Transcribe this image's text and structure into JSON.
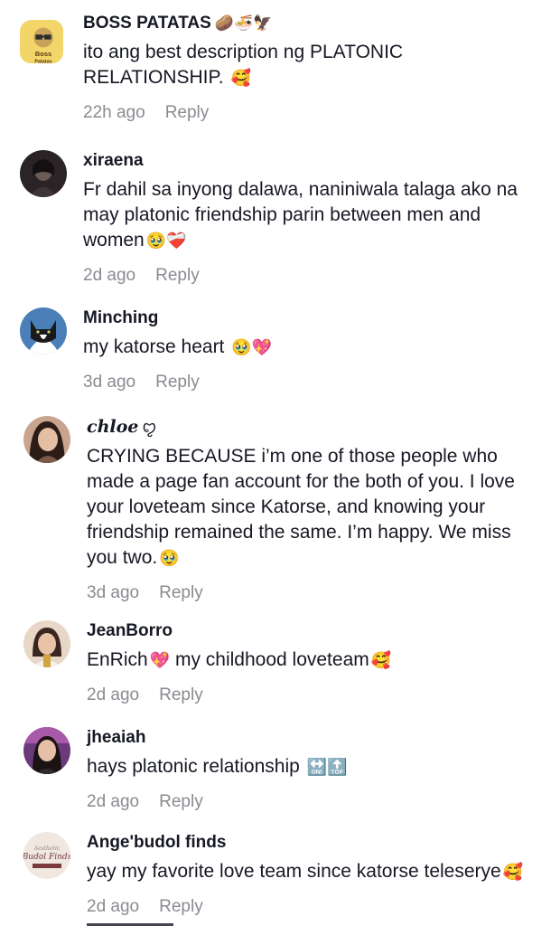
{
  "comments": [
    {
      "username": "BOSS PATATAS",
      "username_decoration": "🥔🍜🦅",
      "text": "ito ang best description ng PLATONIC RELATIONSHIP.",
      "emoji": "🥰",
      "time": "22h ago",
      "reply": "Reply",
      "avatar_text": "Boss Patatas",
      "avatar_bg": "#f2d66a"
    },
    {
      "username": "xiraena",
      "username_decoration": "",
      "text": "Fr dahil sa inyong dalawa, naniniwala talaga ako na may platonic friendship parin between men and women",
      "emoji": "🥹❤️‍🩹",
      "time": "2d ago",
      "reply": "Reply",
      "avatar_bg": "#2a2426"
    },
    {
      "username": "Minching",
      "username_decoration": "",
      "text": "my katorse heart ",
      "emoji": "🥹💖",
      "time": "3d ago",
      "reply": "Reply",
      "avatar_bg": "#4a7fb8"
    },
    {
      "username": "chloe",
      "username_decoration": "ꨄ︎",
      "text": "CRYING BECAUSE i’m one of those people who made a page fan account for the both of you. I love your loveteam since Katorse, and knowing your friendship remained the same. I’m happy. We miss you two.",
      "emoji": "🥹",
      "time": "3d ago",
      "reply": "Reply",
      "avatar_bg": "#c9a48e"
    },
    {
      "username": "JeanBorro",
      "username_decoration": "",
      "text": "EnRich",
      "text_after_emoji": " my childhood loveteam",
      "emoji": "💖",
      "emoji_end": "🥰",
      "time": "2d ago",
      "reply": "Reply",
      "avatar_bg": "#e8d7c7"
    },
    {
      "username": "jheaiah",
      "username_decoration": "",
      "text": "hays platonic relationship ",
      "emoji": "🔛🔝",
      "time": "2d ago",
      "reply": "Reply",
      "avatar_bg": "#6b3a7a"
    },
    {
      "username": "Ange'budol finds",
      "username_decoration": "",
      "text": "yay my favorite love team since katorse teleserye",
      "emoji": "🥰",
      "time": "2d ago",
      "reply": "Reply",
      "avatar_text": "Budol Finds",
      "avatar_bg": "#efe7e0"
    }
  ]
}
